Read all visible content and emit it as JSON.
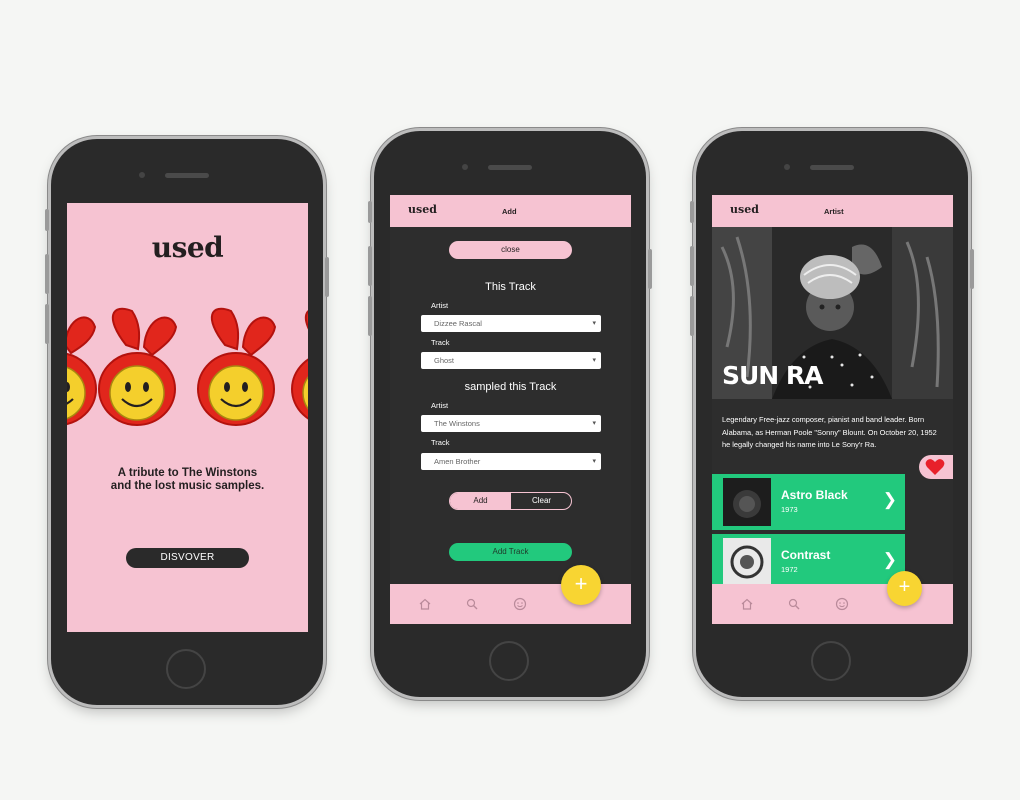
{
  "colors": {
    "pink": "#f6c3d2",
    "dark": "#2d2d2d",
    "green": "#22c97d",
    "yellow": "#f8d532",
    "heart": "#e8202a"
  },
  "screen1": {
    "logo": "used",
    "tagline": "A tribute to The Winstons and the lost music samples.",
    "button": "DISVOVER"
  },
  "screen2": {
    "logo": "used",
    "title": "Add",
    "close": "close",
    "section1": "This Track",
    "section2": "sampled this Track",
    "artist_label": "Artist",
    "track_label": "Track",
    "artist1": "Dizzee Rascal",
    "track1": "Ghost",
    "artist2": "The Winstons",
    "track2": "Amen Brother",
    "seg_add": "Add",
    "seg_clear": "Clear",
    "add_track": "Add Track",
    "fab": "+"
  },
  "screen3": {
    "logo": "used",
    "title": "Artist",
    "artist_name": "SUN RA",
    "bio": "Legendary Free-jazz composer, pianist and band leader. Born Alabama, as Herman Poole \"Sonny\" Blount. On October 20, 1952 he legally changed his name into Le Sony'r Ra.",
    "albums": [
      {
        "name": "Astro Black",
        "year": "1973"
      },
      {
        "name": "Contrast",
        "year": "1972"
      }
    ],
    "fab": "+"
  }
}
